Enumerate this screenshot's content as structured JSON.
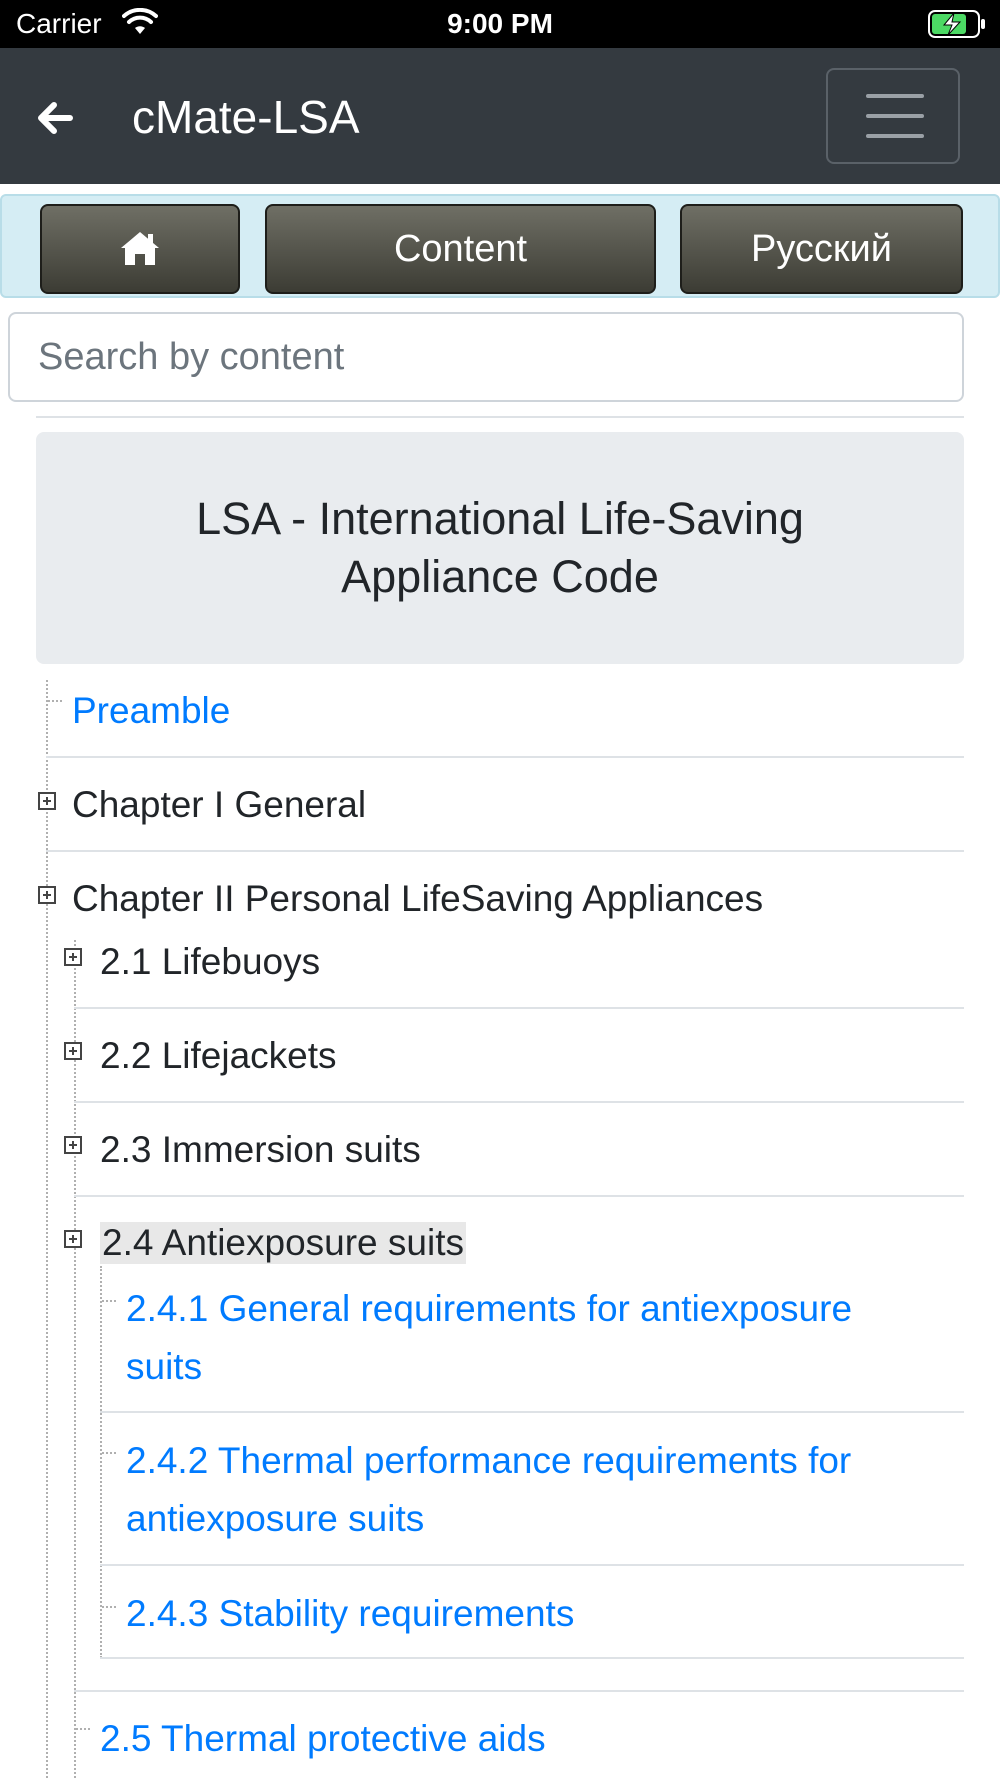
{
  "status_bar": {
    "carrier": "Carrier",
    "time": "9:00 PM"
  },
  "navbar": {
    "title": "cMate-LSA"
  },
  "toolbar": {
    "home_icon": "home-icon",
    "content_label": "Content",
    "language_label": "Русский"
  },
  "search": {
    "placeholder": "Search by content",
    "value": ""
  },
  "document": {
    "title": "LSA - International Life-Saving Appliance Code"
  },
  "tree": {
    "preamble": "Preamble",
    "chapter1": "Chapter I  General",
    "chapter2": "Chapter II  Personal LifeSaving Appliances",
    "s2_1": "2.1 Lifebuoys",
    "s2_2": "2.2 Lifejackets",
    "s2_3": "2.3 Immersion suits",
    "s2_4": "2.4 Antiexposure suits",
    "s2_4_1": "2.4.1 General requirements for antiexposure suits",
    "s2_4_2": "2.4.2 Thermal performance requirements for antiexposure suits",
    "s2_4_3": "2.4.3 Stability requirements",
    "s2_5": "2.5 Thermal protective aids"
  },
  "colors": {
    "navbar_bg": "#343a40",
    "link": "#007bff",
    "toolbar_bg": "#d5edf4",
    "header_bg": "#e9ecef"
  }
}
